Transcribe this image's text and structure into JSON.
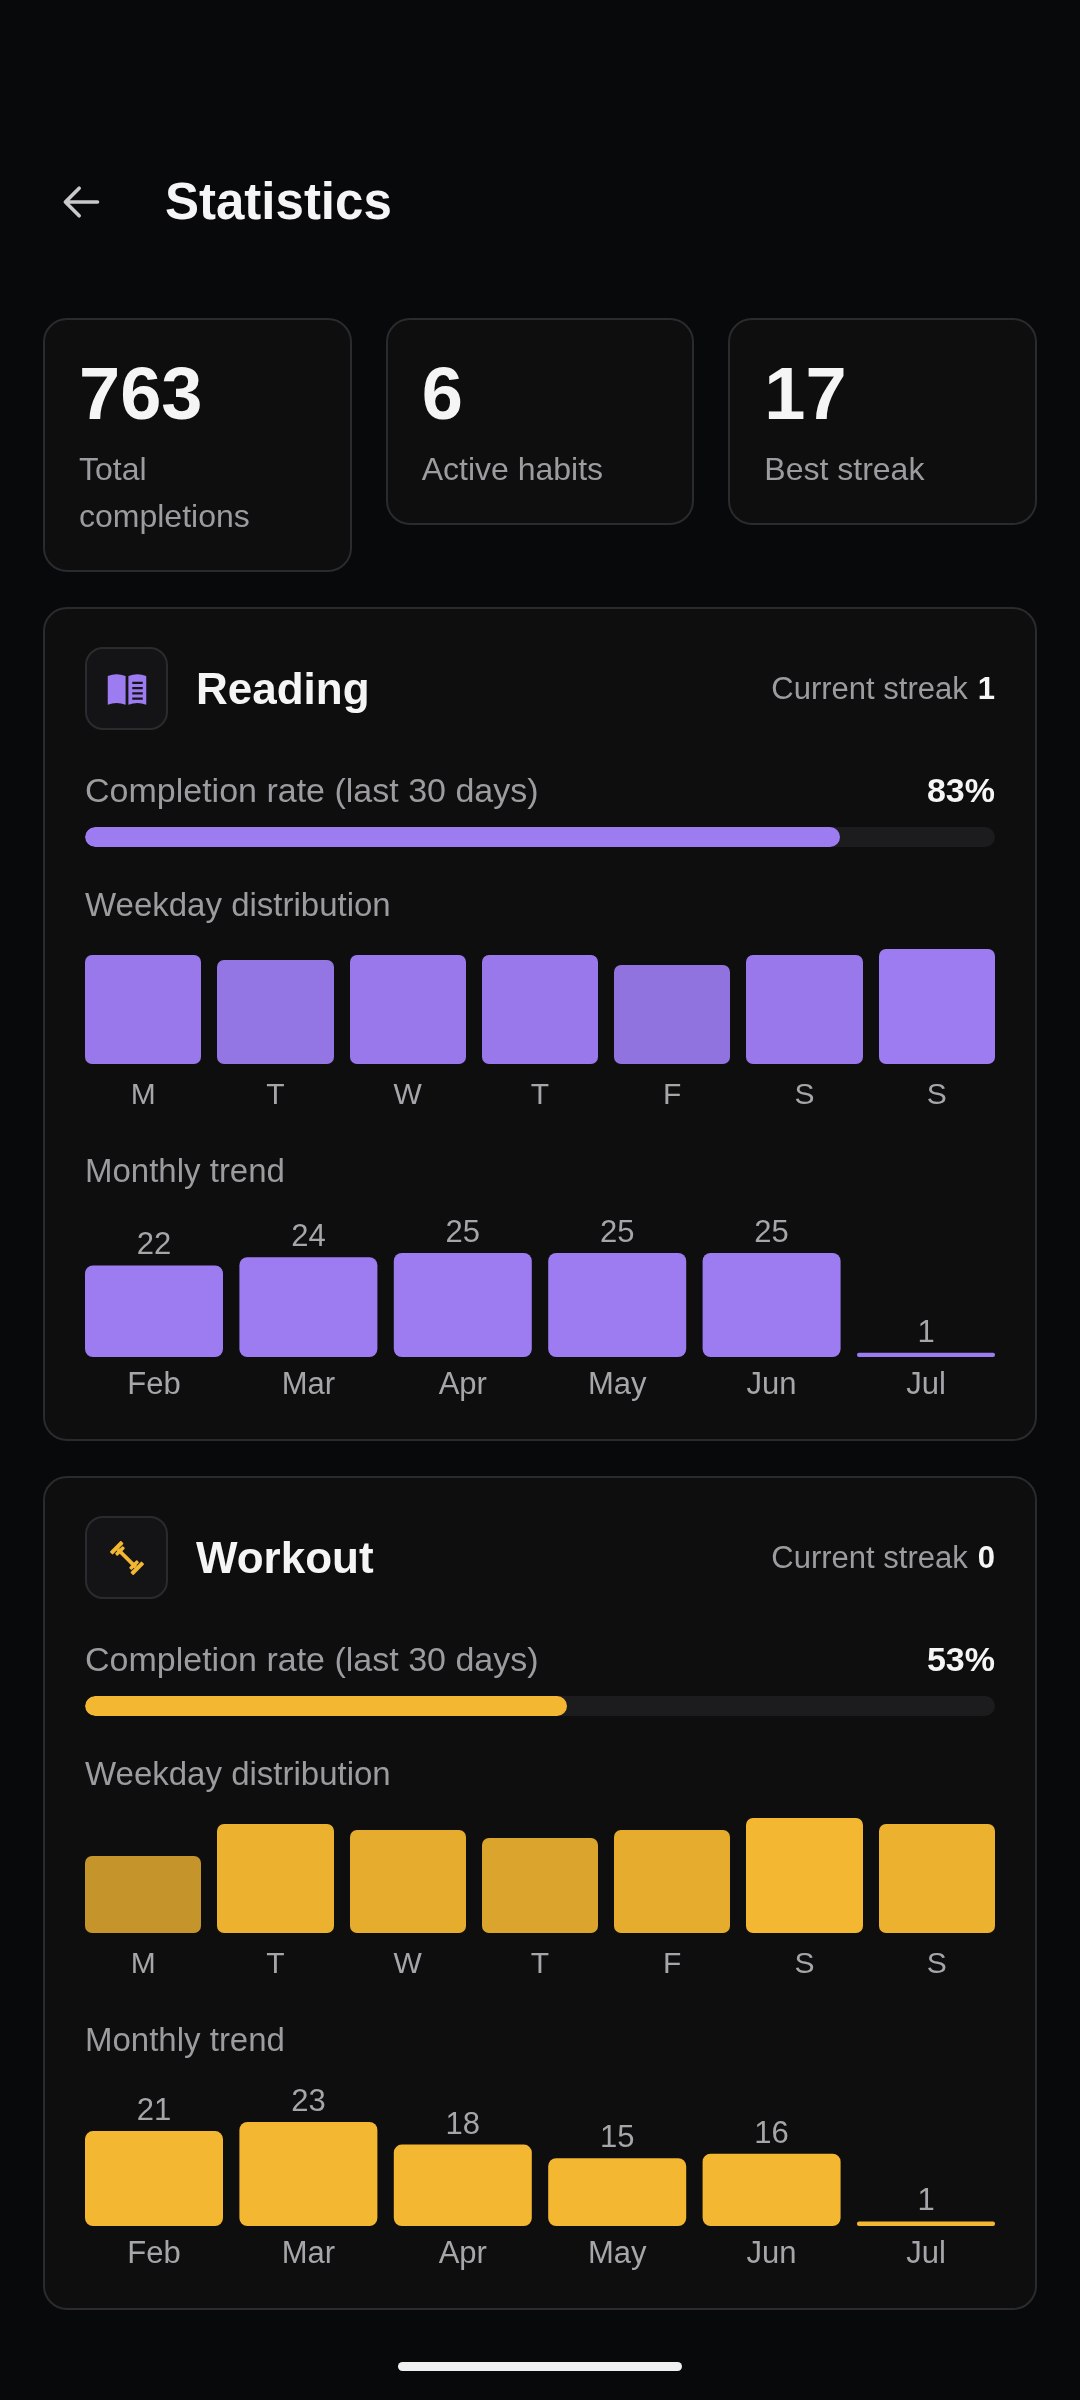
{
  "header": {
    "title": "Statistics"
  },
  "summary": [
    {
      "value": "763",
      "label": "Total completions"
    },
    {
      "value": "6",
      "label": "Active habits"
    },
    {
      "value": "17",
      "label": "Best streak"
    }
  ],
  "habits": [
    {
      "kind": "reading",
      "name": "Reading",
      "color": "#9d7cf2",
      "streak_label": "Current streak",
      "streak": "1",
      "completion": {
        "label": "Completion rate (last 30 days)",
        "percent": "83%",
        "level": 0.83
      },
      "weekday": {
        "title": "Weekday distribution",
        "days": [
          "M",
          "T",
          "W",
          "T",
          "F",
          "S",
          "S"
        ]
      },
      "monthly": {
        "chart_data": {
          "type": "bar",
          "title": "Monthly trend",
          "categories": [
            "Feb",
            "Mar",
            "Apr",
            "May",
            "Jun",
            "Jul"
          ],
          "values": [
            22,
            24,
            25,
            25,
            25,
            1
          ],
          "data_labels": true
        }
      }
    },
    {
      "kind": "workout",
      "name": "Workout",
      "color": "#f4b731",
      "streak_label": "Current streak",
      "streak": "0",
      "completion": {
        "label": "Completion rate (last 30 days)",
        "percent": "53%",
        "level": 0.53
      },
      "weekday": {
        "title": "Weekday distribution",
        "days": [
          "M",
          "T",
          "W",
          "T",
          "F",
          "S",
          "S"
        ]
      },
      "monthly": {
        "chart_data": {
          "type": "bar",
          "title": "Monthly trend",
          "categories": [
            "Feb",
            "Mar",
            "Apr",
            "May",
            "Jun",
            "Jul"
          ],
          "values": [
            21,
            23,
            18,
            15,
            16,
            1
          ],
          "data_labels": true
        }
      }
    }
  ]
}
